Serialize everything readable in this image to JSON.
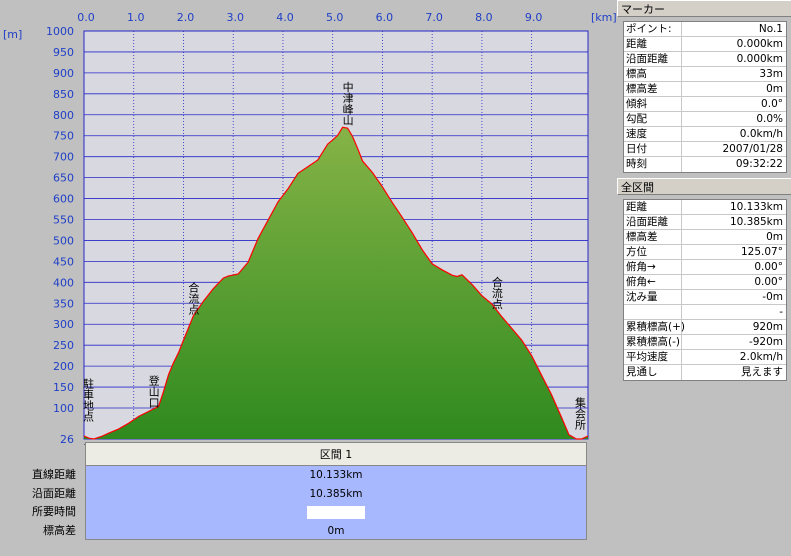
{
  "chart_data": {
    "type": "area",
    "xlabel_unit": "[km]",
    "ylabel_unit": "[m]",
    "xlim": [
      0,
      10.133
    ],
    "ylim": [
      26,
      1000
    ],
    "x_ticks": [
      "0.0",
      "1.0",
      "2.0",
      "3.0",
      "4.0",
      "5.0",
      "6.0",
      "7.0",
      "8.0",
      "9.0"
    ],
    "y_ticks": [
      "1000",
      "950",
      "900",
      "850",
      "800",
      "750",
      "700",
      "650",
      "600",
      "550",
      "500",
      "450",
      "400",
      "350",
      "300",
      "250",
      "200",
      "150",
      "100"
    ],
    "y_base_label": "26",
    "grid": true,
    "x": [
      0,
      0.1,
      0.2,
      0.35,
      0.5,
      0.7,
      0.9,
      1.1,
      1.3,
      1.5,
      1.6,
      1.7,
      1.8,
      1.9,
      2.0,
      2.2,
      2.4,
      2.6,
      2.8,
      2.9,
      3.1,
      3.3,
      3.5,
      3.7,
      3.9,
      4.1,
      4.3,
      4.5,
      4.7,
      4.9,
      5.0,
      5.1,
      5.2,
      5.3,
      5.4,
      5.5,
      5.6,
      5.8,
      6.0,
      6.2,
      6.4,
      6.6,
      6.8,
      7.0,
      7.2,
      7.4,
      7.5,
      7.6,
      7.8,
      8.0,
      8.2,
      8.4,
      8.6,
      8.8,
      9.0,
      9.2,
      9.4,
      9.6,
      9.75,
      9.9,
      10.0,
      10.133
    ],
    "elevation": [
      33,
      28,
      26,
      32,
      40,
      50,
      64,
      80,
      92,
      104,
      140,
      180,
      208,
      232,
      262,
      320,
      355,
      385,
      410,
      415,
      420,
      448,
      505,
      548,
      592,
      623,
      660,
      676,
      692,
      730,
      740,
      751,
      770,
      768,
      748,
      720,
      690,
      662,
      628,
      590,
      555,
      518,
      478,
      444,
      430,
      417,
      414,
      418,
      395,
      368,
      348,
      318,
      290,
      262,
      225,
      178,
      132,
      78,
      36,
      26,
      26,
      33
    ],
    "annotations": [
      {
        "text": "駐車地点",
        "x": 0.0
      },
      {
        "text": "登山口",
        "x": 1.4
      },
      {
        "text": "合流点",
        "x": 2.2
      },
      {
        "text": "中津峰山",
        "x": 5.3
      },
      {
        "text": "合流点",
        "x": 8.3
      },
      {
        "text": "集会所",
        "x": 10.0
      }
    ],
    "colors": {
      "area_top": "#7aab3a",
      "area_bottom": "#2f8a1e",
      "profile_line": "#ff0000",
      "plot_bg": "#d8d8e0",
      "grid": "#2727c8",
      "axis_text": "#1f3fc8"
    }
  },
  "section": {
    "title": "区間 1",
    "rows": [
      {
        "label": "直線距離",
        "value": "10.133km"
      },
      {
        "label": "沿面距離",
        "value": "10.385km"
      },
      {
        "label": "所要時間",
        "value": ""
      },
      {
        "label": "標高差",
        "value": "0m"
      }
    ]
  },
  "marker_panel": {
    "title": "マーカー",
    "rows": [
      {
        "key": "ポイント:",
        "value": "No.1"
      },
      {
        "key": "距離",
        "value": "0.000km"
      },
      {
        "key": "沿面距離",
        "value": "0.000km"
      },
      {
        "key": "標高",
        "value": "33m"
      },
      {
        "key": "標高差",
        "value": "0m"
      },
      {
        "key": "傾斜",
        "value": "0.0°"
      },
      {
        "key": "勾配",
        "value": "0.0%"
      },
      {
        "key": "速度",
        "value": "0.0km/h"
      },
      {
        "key": "日付",
        "value": "2007/01/28"
      },
      {
        "key": "時刻",
        "value": "09:32:22"
      }
    ]
  },
  "all_section_panel": {
    "title": "全区間",
    "rows": [
      {
        "key": "距離",
        "value": "10.133km"
      },
      {
        "key": "沿面距離",
        "value": "10.385km"
      },
      {
        "key": "標高差",
        "value": "0m"
      },
      {
        "key": "方位",
        "value": "125.07°"
      },
      {
        "key": "俯角→",
        "value": "0.00°"
      },
      {
        "key": "俯角←",
        "value": "0.00°"
      },
      {
        "key": "沈み量",
        "value": "-0m"
      },
      {
        "key": "",
        "value": "-"
      },
      {
        "key": "累積標高(+)",
        "value": "920m"
      },
      {
        "key": "累積標高(-)",
        "value": "-920m"
      },
      {
        "key": "平均速度",
        "value": "2.0km/h"
      },
      {
        "key": "見通し",
        "value": "見えます"
      }
    ]
  }
}
